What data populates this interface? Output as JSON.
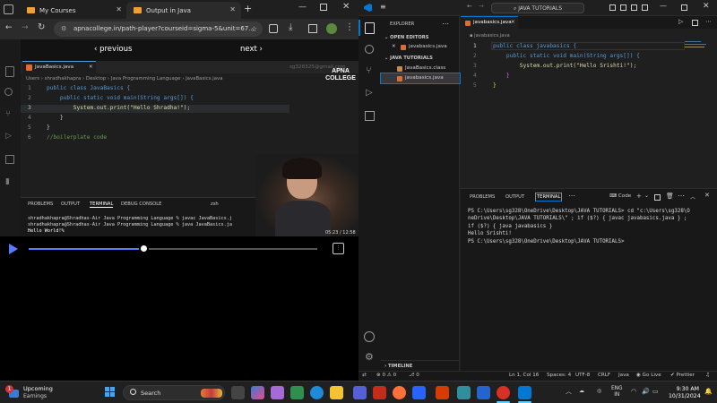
{
  "browser": {
    "tabs": [
      {
        "title": "My Courses",
        "active": false
      },
      {
        "title": "Output in Java",
        "active": true
      }
    ],
    "url": "apnacollege.in/path-player?courseid=sigma-5&unit=67...",
    "nav_prev": "‹ previous",
    "nav_next": "next ›"
  },
  "video": {
    "tab_name": "JavaBasics.java",
    "breadcrumb": "Users › shradhakhapra › Desktop › Java Programming Language › JavaBasics.java",
    "watermark_id": "sg328325@gmail.com",
    "brand": "APNA COLLEGE",
    "code_lines": [
      "public class JavaBasics {",
      "    public static void main(String args[]) {",
      "        System.out.print(\"Hello Shradha!\");",
      "    }",
      "}",
      "//boilerplate code"
    ],
    "line_numbers": [
      "1",
      "2",
      "3",
      "4",
      "5",
      "6"
    ],
    "panel_tabs": [
      "PROBLEMS",
      "OUTPUT",
      "TERMINAL",
      "DEBUG CONSOLE"
    ],
    "shell": "zsh",
    "terminal_lines": [
      "shradhakhapra@Shradhas-Air Java Programming Language % javac JavaBasics.j",
      "shradhakhapra@Shradhas-Air Java Programming Language % java JavaBasics.ja",
      "Hello World!%"
    ],
    "time_display": "05:23 / 12:58",
    "progress": 0.4
  },
  "vscode": {
    "search_title": "JAVA TUTORIALS",
    "explorer_title": "EXPLORER",
    "open_editors": "OPEN EDITORS",
    "open_editor_file": "javabasics.java",
    "folder": "JAVA TUTORIALS",
    "files": [
      "JavaBasics.class",
      "javabasics.java"
    ],
    "timeline": "TIMELINE",
    "editor_tab": "javabasics.java",
    "breadcrumb": "javabasics.java",
    "code_lines": [
      "public class javabasics {",
      "    public static void main(String args[]) {",
      "        System.out.print(\"Hello Srishti!\");",
      "    }",
      "}"
    ],
    "line_numbers": [
      "1",
      "2",
      "3",
      "4",
      "5"
    ],
    "panel_tabs": [
      "PROBLEMS",
      "OUTPUT",
      "TERMINAL"
    ],
    "panel_right_label": "Code",
    "terminal_lines": [
      "PS C:\\Users\\sg328\\OneDrive\\Desktop\\JAVA TUTORIALS> cd \"c:\\Users\\sg328\\O",
      "neDrive\\Desktop\\JAVA TUTORIALS\\\" ; if ($?) { javac javabasics.java } ;",
      " if ($?) { java javabasics }",
      "Hello Srishti!",
      "PS C:\\Users\\sg328\\OneDrive\\Desktop\\JAVA TUTORIALS>"
    ],
    "status": {
      "errors": "0",
      "warnings": "0",
      "ports": "0",
      "position": "Ln 1, Col 16",
      "spaces": "Spaces: 4",
      "encoding": "UTF-8",
      "eol": "CRLF",
      "lang": "Java",
      "golive": "Go Live",
      "prettier": "Prettier"
    }
  },
  "taskbar": {
    "weather_title": "Upcoming",
    "weather_sub": "Earnings",
    "weather_badge": "1",
    "search": "Search",
    "lang_top": "ENG",
    "lang_bottom": "IN",
    "time": "9:30 AM",
    "date": "10/31/2024"
  },
  "colors": {
    "accent": "#0078d4",
    "keyword": "#569cd6",
    "string": "#ce9178",
    "func": "#dcdcaa",
    "type": "#4ec9b0",
    "comment": "#6a9955",
    "progress": "#5b7bff"
  }
}
